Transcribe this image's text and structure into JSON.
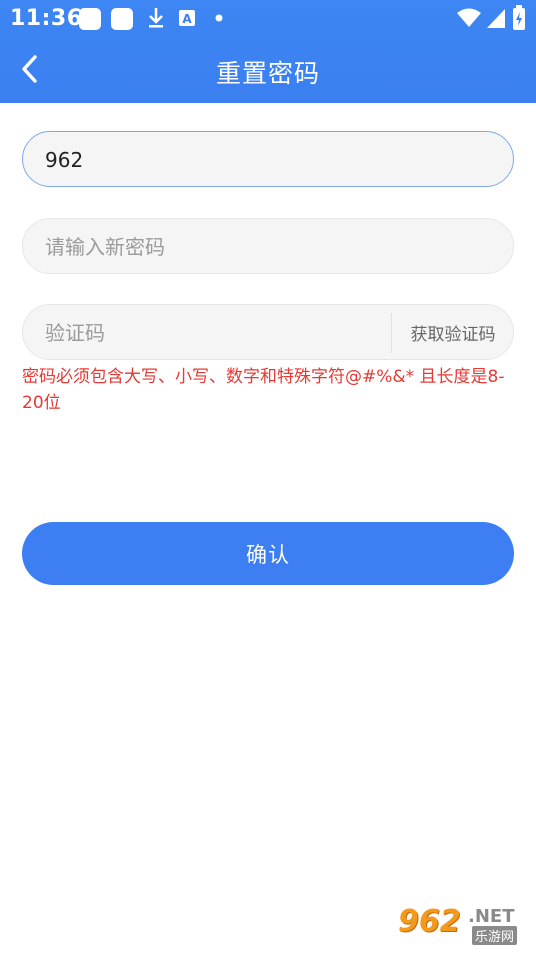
{
  "status_bar": {
    "time": "11:36",
    "notification_icons": [
      "app-square-icon",
      "app-square-icon",
      "download-icon",
      "font-icon",
      "dot-icon"
    ],
    "right_icons": [
      "wifi-icon",
      "signal-icon",
      "battery-icon"
    ]
  },
  "header": {
    "title": "重置密码",
    "back_icon": "chevron-left-icon",
    "background_color": "#3b7ff0"
  },
  "form": {
    "account": {
      "value": "962",
      "placeholder": ""
    },
    "new_password": {
      "value": "",
      "placeholder": "请输入新密码"
    },
    "verification_code": {
      "value": "",
      "placeholder": "验证码"
    },
    "get_code_label": "获取验证码",
    "hint": "密码必须包含大写、小写、数字和特殊字符@#%&* 且长度是8-20位",
    "hint_color": "#e53935"
  },
  "confirm_button": {
    "label": "确认",
    "color": "#3d7ef2"
  },
  "watermark": {
    "number": "962",
    "net": ".NET",
    "sub": "乐游网"
  }
}
